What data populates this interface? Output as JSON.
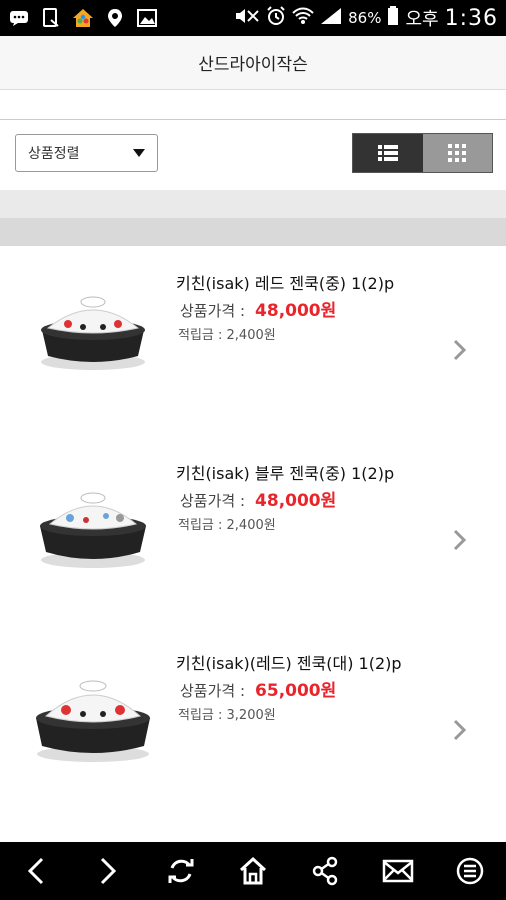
{
  "status_bar": {
    "battery": "86%",
    "ampm": "오후",
    "time": "1:36",
    "icons": [
      "message-icon",
      "screen-icon",
      "app-icon",
      "location-icon",
      "gallery-icon",
      "mute-icon",
      "alarm-icon",
      "wifi-icon",
      "signal-icon",
      "battery-icon"
    ]
  },
  "header": {
    "title": "산드라아이작슨"
  },
  "search": {
    "placeholder": ""
  },
  "controls": {
    "sort_label": "상품정렬",
    "view_modes": [
      "list-view",
      "grid-view"
    ],
    "active_view": "list-view"
  },
  "products": [
    {
      "name": "키친(isak) 레드 젠쿡(중) 1(2)p",
      "price_label": "상품가격 :",
      "price": "48,000원",
      "points": "적립금 : 2,400원",
      "variant": "red"
    },
    {
      "name": "키친(isak) 블루 젠쿡(중) 1(2)p",
      "price_label": "상품가격 :",
      "price": "48,000원",
      "points": "적립금 : 2,400원",
      "variant": "blue"
    },
    {
      "name": "키친(isak)(레드) 젠쿡(대) 1(2)p",
      "price_label": "상품가격 :",
      "price": "65,000원",
      "points": "적립금 : 3,200원",
      "variant": "red"
    }
  ],
  "bottom_nav": [
    "back-icon",
    "forward-icon",
    "refresh-icon",
    "home-icon",
    "share-icon",
    "mail-icon",
    "menu-icon"
  ],
  "colors": {
    "price": "#e8252b",
    "toggle_active": "#333333",
    "toggle_inactive": "#999999"
  }
}
